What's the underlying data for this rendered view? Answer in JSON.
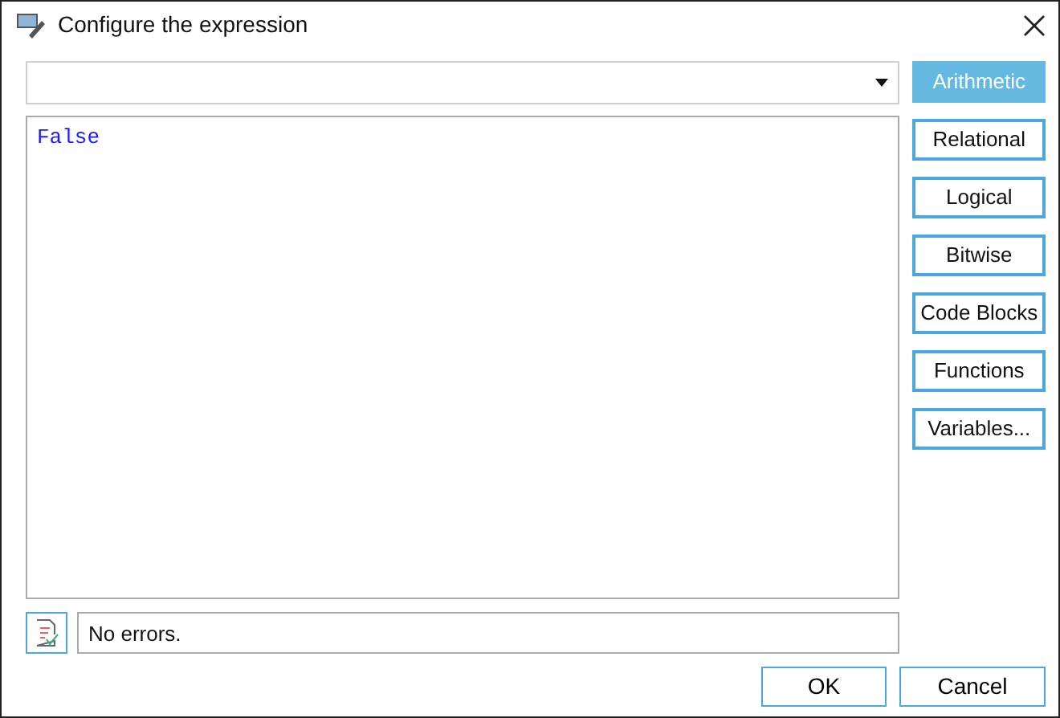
{
  "window": {
    "title": "Configure the expression"
  },
  "editor": {
    "text": "False"
  },
  "categories": [
    {
      "label": "Arithmetic",
      "selected": true
    },
    {
      "label": "Relational",
      "selected": false
    },
    {
      "label": "Logical",
      "selected": false
    },
    {
      "label": "Bitwise",
      "selected": false
    },
    {
      "label": "Code Blocks",
      "selected": false
    },
    {
      "label": "Functions",
      "selected": false
    },
    {
      "label": "Variables...",
      "selected": false
    }
  ],
  "status": {
    "message": "No errors."
  },
  "buttons": [
    "OK",
    "Cancel"
  ]
}
